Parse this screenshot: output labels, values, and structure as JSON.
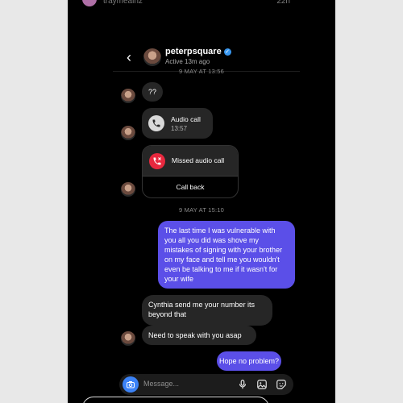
{
  "top": {
    "username": "traymealnz",
    "meta": "22h"
  },
  "header": {
    "username": "peterpsquare",
    "status": "Active 13m ago",
    "verified_mark": "✓"
  },
  "date_separators": [
    "9 MAY AT 13:56",
    "9 MAY AT 15:10"
  ],
  "messages": {
    "m1": "??",
    "audio_call": {
      "title": "Audio call",
      "time": "13:57"
    },
    "missed_call": {
      "title": "Missed audio call",
      "callback_label": "Call back"
    },
    "out1": "The last time I was vulnerable with you all you did was shove my mistakes of signing with your brother on my face and tell me you wouldn't even be talking to me if it wasn't for your wife",
    "in2": "Cynthia send me your number its beyond that",
    "in3": "Need to speak with you asap",
    "out2": "Hope no problem?"
  },
  "composer": {
    "placeholder": "Message..."
  },
  "icons": {
    "back": "chevron-left-icon",
    "camera": "camera-icon",
    "mic": "microphone-icon",
    "gallery": "image-icon",
    "sticker": "sticker-icon",
    "phone": "phone-icon",
    "missed": "missed-call-icon"
  },
  "colors": {
    "accent": "#3897f0",
    "outgoing_bubble": "#5b4fe8",
    "missed_red": "#e8283e"
  }
}
